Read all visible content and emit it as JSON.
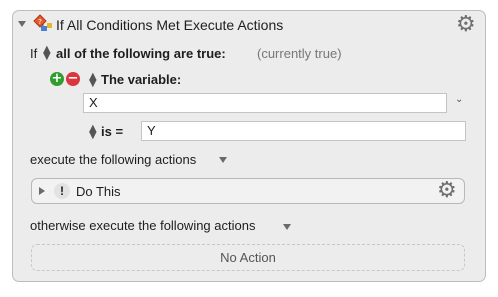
{
  "action": {
    "title": "If All Conditions Met Execute Actions",
    "icon": "keyboard-maestro-action-icon"
  },
  "condition": {
    "if_label": "If",
    "match_mode": "all of the following are true:",
    "status": "(currently true)",
    "variable_label": "The variable:",
    "variable_name": "X",
    "operator": "is =",
    "compare_value": "Y"
  },
  "then_section": {
    "label": "execute the following actions",
    "actions": [
      {
        "name": "Do This"
      }
    ]
  },
  "else_section": {
    "label": "otherwise execute the following actions",
    "placeholder": "No Action"
  },
  "colors": {
    "add": "#2f9e2f",
    "remove": "#d9363e"
  }
}
